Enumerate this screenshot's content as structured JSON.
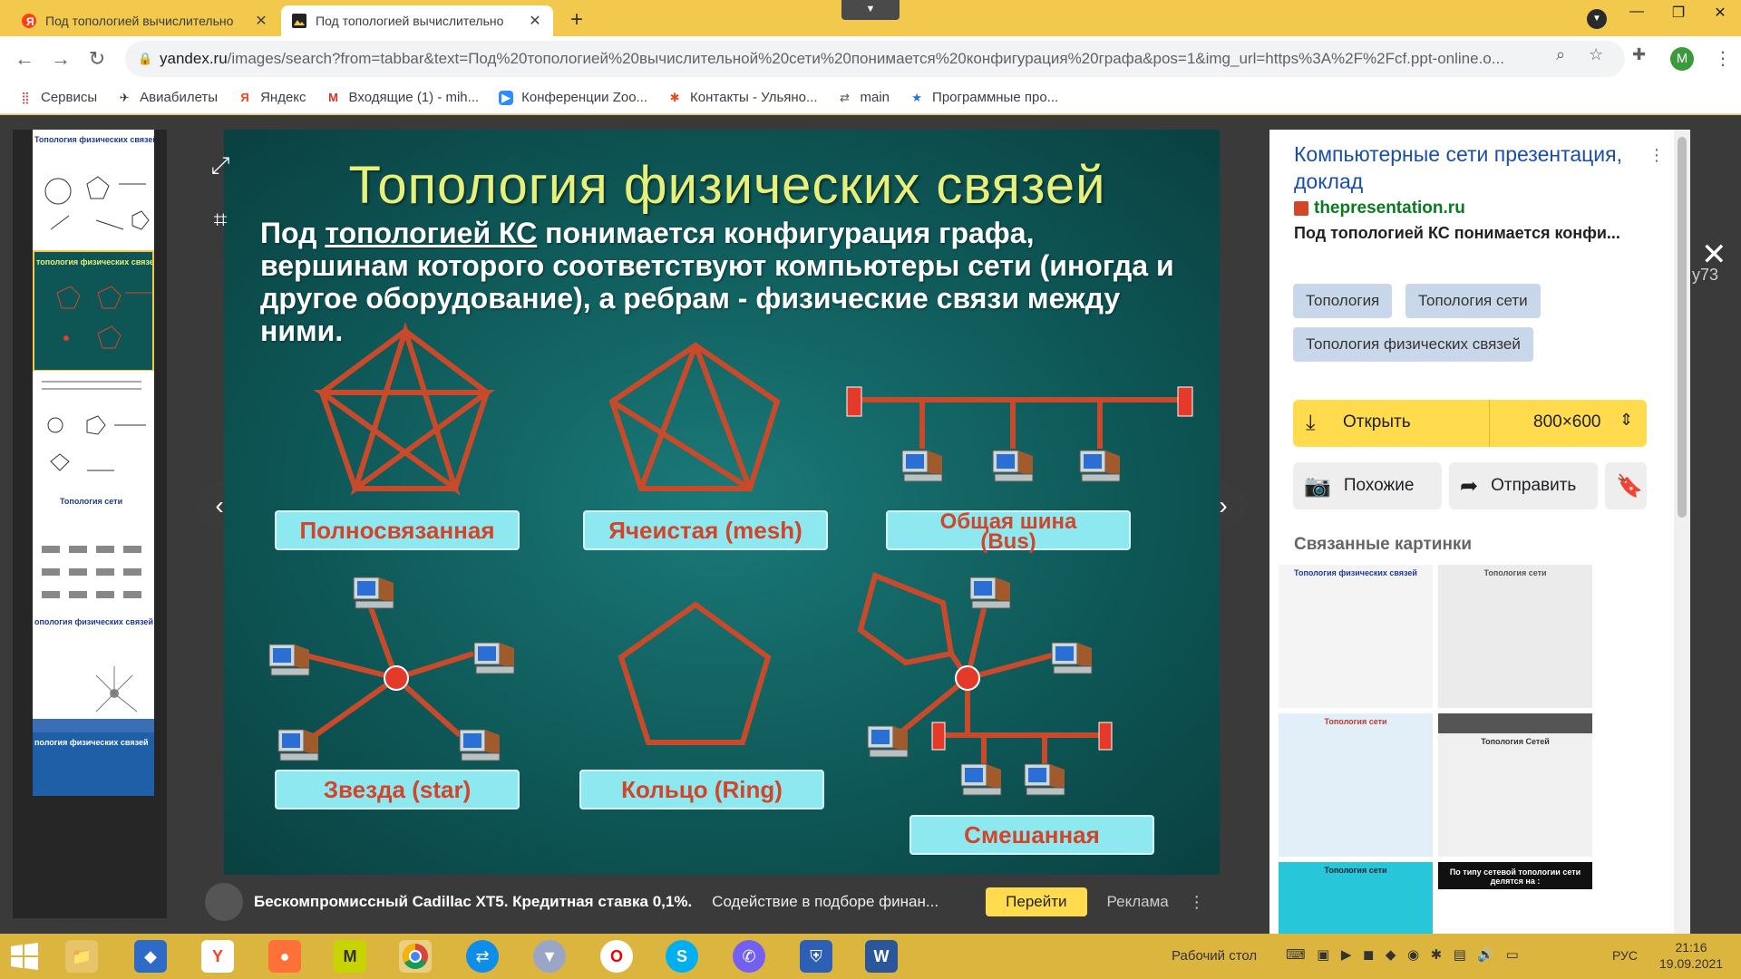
{
  "tabs": [
    {
      "title": "Под топологией вычислительно",
      "favicon": "yandex-icon"
    },
    {
      "title": "Под топологией вычислительно",
      "favicon": "image-icon",
      "active": true
    }
  ],
  "toolbar": {
    "url_host": "yandex.ru",
    "url_rest": "/images/search?from=tabbar&text=Под%20топологией%20вычислительной%20сети%20понимается%20конфигурация%20графа&pos=1&img_url=https%3A%2F%2Fcf.ppt-online.o...",
    "avatar_letter": "M"
  },
  "bookmarks": [
    {
      "label": "Сервисы",
      "icon": "apps-icon"
    },
    {
      "label": "Авиабилеты",
      "icon": "plane-icon"
    },
    {
      "label": "Яндекс",
      "icon": "yandex-icon"
    },
    {
      "label": "Входящие (1) - mih...",
      "icon": "gmail-icon"
    },
    {
      "label": "Конференции Zoo...",
      "icon": "zoom-icon"
    },
    {
      "label": "Контакты - Ульяно...",
      "icon": "joomla-icon"
    },
    {
      "label": "main",
      "icon": "link-icon"
    },
    {
      "label": "Программные про...",
      "icon": "star-icon"
    }
  ],
  "thumbnails": [
    {
      "title": "Топология физических связей"
    },
    {
      "title": "топология физических связе"
    },
    {
      "title": ""
    },
    {
      "title": "Топология сети"
    },
    {
      "title": "опология физических связей"
    },
    {
      "title": "пология физических связей"
    }
  ],
  "slide": {
    "title": "Топология физических связей",
    "desc_before": "Под ",
    "desc_underlined": "топологией КС",
    "desc_after": " понимается конфигурация графа, вершинам которого соответствуют компьютеры сети (иногда и другое оборудование), а ребрам - физические связи между ними.",
    "labels": {
      "full": "Полносвязанная",
      "mesh": "Ячеистая (mesh)",
      "bus": "Общая шина (Bus)",
      "star": "Звезда (star)",
      "ring": "Кольцо (Ring)",
      "mixed": "Смешанная"
    }
  },
  "ad": {
    "title": "Бескомпромиссный Cadillac XT5. Кредитная ставка 0,1%.",
    "text": "Содействие в подборе финан...",
    "go": "Перейти",
    "label": "Реклама"
  },
  "side": {
    "title": "Компьютерные сети презентация, доклад",
    "source": "thepresentation.ru",
    "snippet": "Под топологией КС понимается конфи...",
    "chips": [
      "Топология",
      "Топология сети",
      "Топология физических связей"
    ],
    "open_label": "Открыть",
    "size": "800×600",
    "similar_label": "Похожие",
    "share_label": "Отправить",
    "related_title": "Связанные картинки",
    "related": [
      {
        "title": "Топология физических связей"
      },
      {
        "title": "Топология сети"
      },
      {
        "title": "Топология сети"
      },
      {
        "title": "Топология Сетей"
      },
      {
        "title": "Топология сети"
      },
      {
        "title": "По типу сетевой топологии сети делятся на :"
      }
    ],
    "extra_text": "у73"
  },
  "taskbar": {
    "desktop_label": "Рабочий стол",
    "lang": "РУС",
    "time": "21:16",
    "date": "19.09.2021"
  }
}
